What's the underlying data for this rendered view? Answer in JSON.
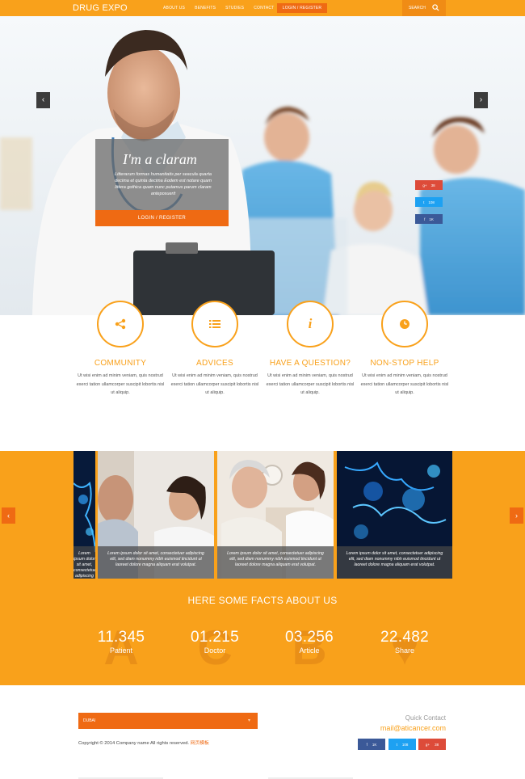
{
  "header": {
    "logo": "DRUG EXPO",
    "nav": [
      "ABOUT US",
      "BENEFITS",
      "STUDIES",
      "CONTACT"
    ],
    "login_label": "LOGIN / REGISTER",
    "search_label": "SEARCH"
  },
  "hero": {
    "title": "I'm a claram",
    "text": "Litterarum formas humanitatis per seacula quarta decima et quinta decima Eodem est notare quam littera gothica quam nunc putamus parum claram anteposuerit",
    "button_label": "LOGIN / REGISTER",
    "social": [
      {
        "network": "google-plus",
        "icon": "g+",
        "count": "38",
        "color": "#dd4b39"
      },
      {
        "network": "twitter",
        "icon": "t",
        "count": "108",
        "color": "#1da1f2"
      },
      {
        "network": "facebook",
        "icon": "f",
        "count": "1K",
        "color": "#3b5998"
      }
    ]
  },
  "features": [
    {
      "title": "COMMUNITY",
      "icon": "share-icon",
      "text": "Ut wisi enim ad minim veniam, quis nostrud exerci tation ullamcorper suscipit lobortis nisl ut aliquip."
    },
    {
      "title": "ADVICES",
      "icon": "list-icon",
      "text": "Ut wisi enim ad minim veniam, quis nostrud exerci tation ullamcorper suscipit lobortis nisl ut aliquip."
    },
    {
      "title": "HAVE A QUESTION?",
      "icon": "info-icon",
      "text": "Ut wisi enim ad minim veniam, quis nostrud exerci tation ullamcorper suscipit lobortis nisl ut aliquip."
    },
    {
      "title": "NON-STOP HELP",
      "icon": "clock-icon",
      "text": "Ut wisi enim ad minim veniam, quis nostrud exerci tation ullamcorper suscipit lobortis nisl ut aliquip."
    }
  ],
  "gallery": {
    "caption": "Lorem ipsum dolor sit amet, consectetuer adipiscing elit, sed diam nonummy nibh euismod tincidunt ut laoreet dolore magna aliquam erat volutpat."
  },
  "facts": {
    "heading": "HERE SOME FACTS ABOUT US",
    "items": [
      {
        "value": "11.345",
        "label": "Patient",
        "bg_glyph": "A"
      },
      {
        "value": "01.215",
        "label": "Doctor",
        "bg_glyph": "C"
      },
      {
        "value": "03.256",
        "label": "Article",
        "bg_glyph": "B"
      },
      {
        "value": "22.482",
        "label": "Share",
        "bg_glyph": "♥"
      }
    ]
  },
  "footer": {
    "language": "DUBAI",
    "copyright": "Copyright © 2014 Company name All rights reserved.",
    "copyright_accent": "网页模板",
    "quick_contact_label": "Quick Contact",
    "email": "mail@aticancer.com",
    "social": [
      {
        "network": "facebook",
        "icon": "f",
        "count": "1K",
        "color": "#3b5998"
      },
      {
        "network": "twitter",
        "icon": "t",
        "count": "108",
        "color": "#1da1f2"
      },
      {
        "network": "google-plus",
        "icon": "g+",
        "count": "38",
        "color": "#dd4b39"
      }
    ]
  },
  "colors": {
    "primary": "#f9a11b",
    "accent": "#ef6a13"
  }
}
